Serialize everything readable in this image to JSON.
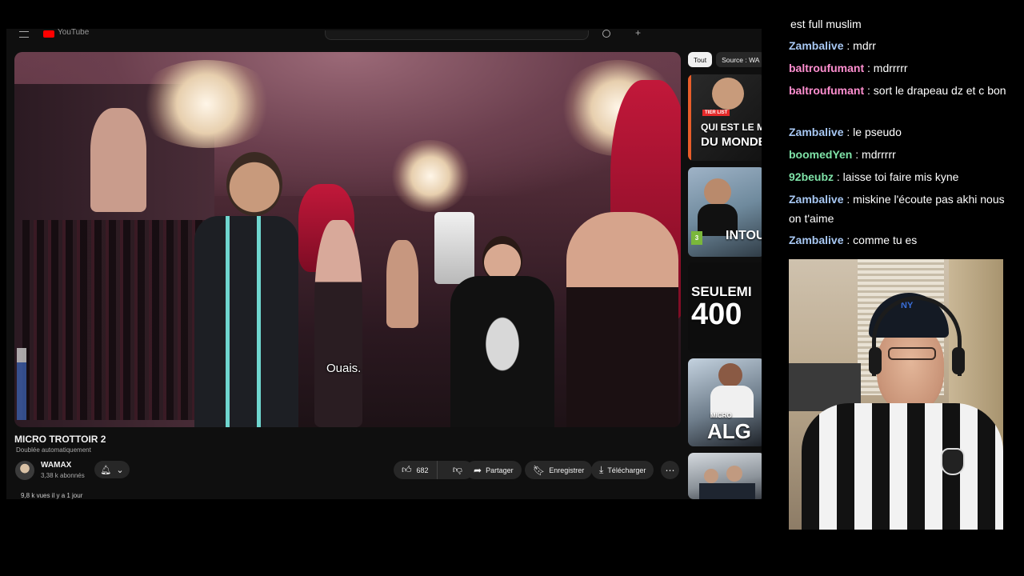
{
  "youtube": {
    "brand": "YouTube",
    "chips": [
      "Tout",
      "Source : WA"
    ],
    "subtitle": "Ouais.",
    "video_title": "MICRO TROTTOIR 2",
    "dub_label": "Doublée automatiquement",
    "channel": {
      "name": "WAMAX",
      "subscribers": "3,38 k abonnés"
    },
    "likes": "682",
    "actions": {
      "share": "Partager",
      "save": "Enregistrer",
      "download": "Télécharger"
    },
    "views": "9,8 k vues  il y a 1 jour",
    "icons": {
      "menu": "menu-icon",
      "bell": "bell-icon",
      "chevron": "chevron-down-icon",
      "like": "thumbs-up-icon",
      "dislike": "thumbs-down-icon",
      "share": "share-icon",
      "save": "bookmark-icon",
      "download": "download-icon",
      "more": "more-icon"
    },
    "recommended": [
      {
        "tag": "TIER LIST",
        "line1": "QUI EST LE MI",
        "line2": "DU MONDE"
      },
      {
        "line1": "INTOU",
        "rating": "3"
      },
      {
        "line1": "SEULEMI",
        "line2": "400"
      },
      {
        "line1": "MICRO",
        "line2": "ALG"
      },
      {}
    ]
  },
  "chat": {
    "username_colors": {
      "Zambalive": "#a7c7f2",
      "baltroufumant": "#ff8fd0",
      "boomedYen": "#7fe3a8",
      "92beubz": "#7fe3a8"
    },
    "messages": [
      {
        "user": "",
        "text": "est full muslim"
      },
      {
        "user": "Zambalive",
        "text": ": mdrr"
      },
      {
        "user": "baltroufumant",
        "text": ": mdrrrrr"
      },
      {
        "user": "baltroufumant",
        "text": ": sort le drapeau dz et c bon"
      },
      {
        "user": "Zambalive",
        "text": ": le pseudo"
      },
      {
        "user": "boomedYen",
        "text": ": mdrrrrr"
      },
      {
        "user": "92beubz",
        "text": ": laisse toi faire mis kyne"
      },
      {
        "user": "Zambalive",
        "text": ": miskine l'écoute pas akhi nous on t'aime"
      },
      {
        "user": "Zambalive",
        "text": ": comme tu es"
      }
    ]
  }
}
